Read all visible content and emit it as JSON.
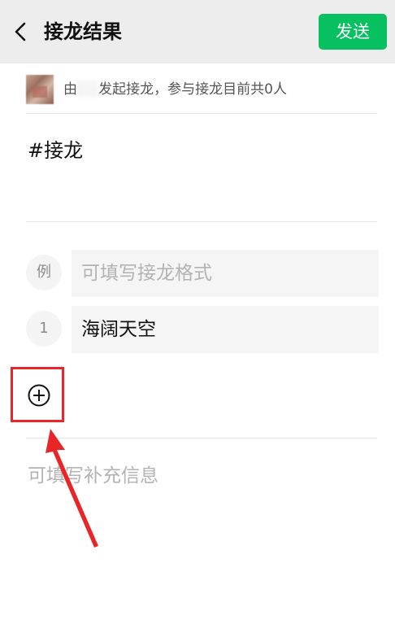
{
  "header": {
    "title": "接龙结果",
    "send_label": "发送"
  },
  "initiator": {
    "prefix": "由",
    "name": "░░",
    "suffix": "发起接龙，参与接龙目前共0人"
  },
  "topic": "#接龙",
  "rows": [
    {
      "num": "例",
      "text": "可填写接龙格式",
      "is_placeholder": true
    },
    {
      "num": "1",
      "text": "海阔天空",
      "is_placeholder": false
    }
  ],
  "supplement_placeholder": "可填写补充信息",
  "icons": {
    "back": "chevron-left-icon",
    "add": "plus-circle-icon"
  },
  "colors": {
    "accent": "#07c160",
    "highlight": "#e8262a"
  }
}
